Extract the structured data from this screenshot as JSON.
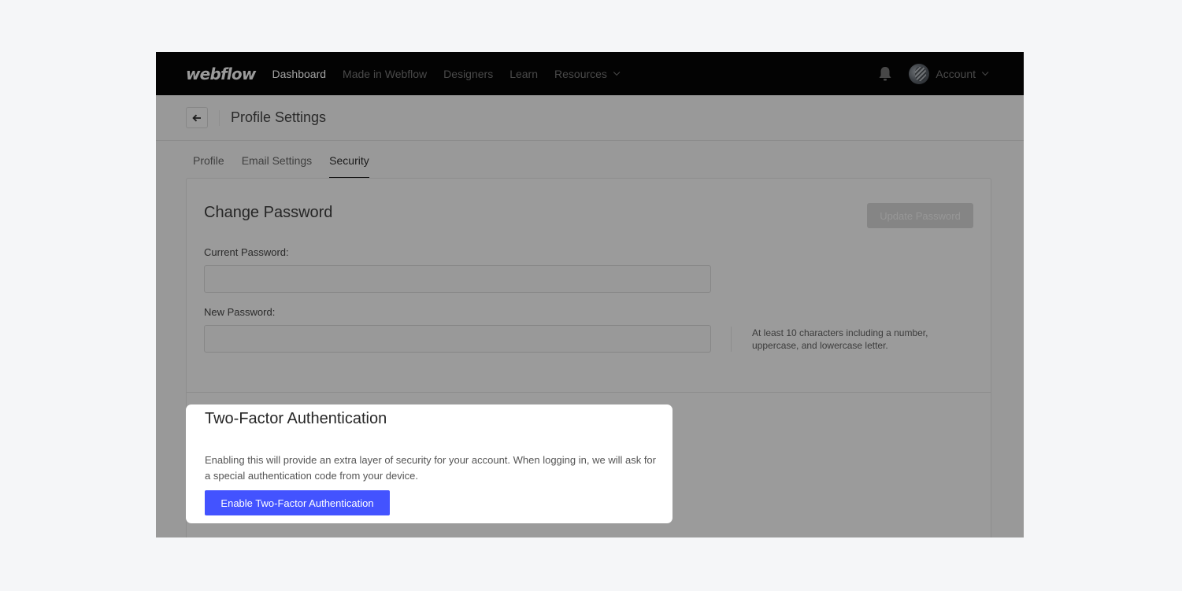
{
  "nav": {
    "logo": "webflow",
    "links": [
      {
        "label": "Dashboard",
        "active": true
      },
      {
        "label": "Made in Webflow",
        "active": false
      },
      {
        "label": "Designers",
        "active": false
      },
      {
        "label": "Learn",
        "active": false
      },
      {
        "label": "Resources",
        "active": false,
        "has_dropdown": true
      }
    ],
    "notification_icon": "bell-icon",
    "account_label": "Account"
  },
  "header": {
    "back_icon": "arrow-left-icon",
    "title": "Profile Settings"
  },
  "tabs": [
    {
      "label": "Profile",
      "active": false
    },
    {
      "label": "Email Settings",
      "active": false
    },
    {
      "label": "Security",
      "active": true
    }
  ],
  "change_password": {
    "title": "Change Password",
    "update_button": "Update Password",
    "current_label": "Current Password:",
    "current_value": "",
    "new_label": "New Password:",
    "new_value": "",
    "hint": "At least 10 characters including a number, uppercase, and lowercase letter."
  },
  "two_factor": {
    "title": "Two-Factor Authentication",
    "description": "Enabling this will provide an extra layer of security for your account. When logging in, we will ask for a special authentication code from your device.",
    "button": "Enable Two-Factor Authentication"
  },
  "colors": {
    "accent": "#4353ff",
    "nav_bg": "#030303",
    "overlay": "#999999",
    "page_bg": "#f5f6f8"
  }
}
